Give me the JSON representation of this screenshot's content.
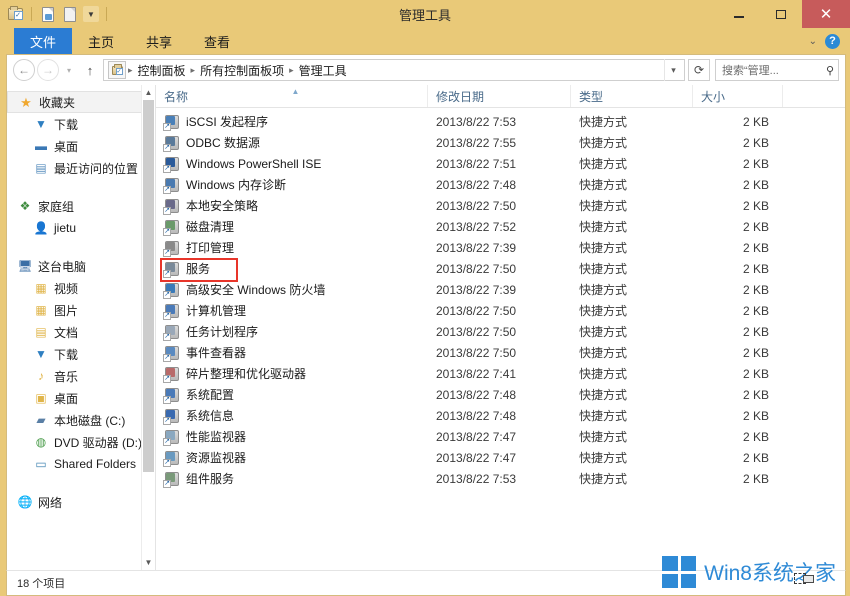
{
  "window": {
    "title": "管理工具",
    "minimize_label": "最小化",
    "maximize_label": "最大化",
    "close_label": "关闭"
  },
  "quick_access": {
    "items": [
      {
        "name": "folder-properties-icon",
        "label": "属性"
      },
      {
        "name": "new-folder-icon",
        "label": "新建文件夹"
      },
      {
        "name": "properties-icon",
        "label": "属性"
      },
      {
        "name": "customize-caret-icon",
        "label": "自定义快速访问工具栏"
      }
    ]
  },
  "ribbon": {
    "tabs": [
      {
        "label": "文件",
        "active": true
      },
      {
        "label": "主页",
        "active": false
      },
      {
        "label": "共享",
        "active": false
      },
      {
        "label": "查看",
        "active": false
      }
    ],
    "collapse_label": "展开功能区",
    "help_label": "?"
  },
  "address": {
    "back_label": "后退",
    "forward_label": "前进",
    "recent_label": "最近的位置",
    "up_label": "上移一级",
    "breadcrumbs": [
      "控制面板",
      "所有控制面板项",
      "管理工具"
    ],
    "separator": "▸",
    "dropdown_label": "▾",
    "refresh_label": "刷新",
    "search_placeholder": "搜索“管理..."
  },
  "sidebar": {
    "groups": [
      {
        "header": {
          "label": "收藏夹",
          "icon": "star-icon",
          "selected": true
        },
        "items": [
          {
            "label": "下载",
            "icon": "downloads-icon"
          },
          {
            "label": "桌面",
            "icon": "desktop-icon"
          },
          {
            "label": "最近访问的位置",
            "icon": "recent-places-icon"
          }
        ]
      },
      {
        "header": {
          "label": "家庭组",
          "icon": "homegroup-icon",
          "selected": false
        },
        "items": [
          {
            "label": "jietu",
            "icon": "user-icon"
          }
        ]
      },
      {
        "header": {
          "label": "这台电脑",
          "icon": "this-pc-icon",
          "selected": false
        },
        "items": [
          {
            "label": "视频",
            "icon": "videos-folder-icon"
          },
          {
            "label": "图片",
            "icon": "pictures-folder-icon"
          },
          {
            "label": "文档",
            "icon": "documents-folder-icon"
          },
          {
            "label": "下载",
            "icon": "downloads-folder-icon"
          },
          {
            "label": "音乐",
            "icon": "music-folder-icon"
          },
          {
            "label": "桌面",
            "icon": "desktop-folder-icon"
          },
          {
            "label": "本地磁盘 (C:)",
            "icon": "local-disk-icon"
          },
          {
            "label": "DVD 驱动器 (D:)",
            "icon": "dvd-drive-icon"
          },
          {
            "label": "Shared Folders",
            "icon": "shared-folders-icon"
          }
        ]
      },
      {
        "header": {
          "label": "网络",
          "icon": "network-icon",
          "selected": false
        },
        "items": []
      }
    ]
  },
  "filelist": {
    "columns": [
      {
        "label": "名称",
        "sorted": true
      },
      {
        "label": "修改日期",
        "sorted": false
      },
      {
        "label": "类型",
        "sorted": false
      },
      {
        "label": "大小",
        "sorted": false
      }
    ],
    "rows": [
      {
        "name": "iSCSI 发起程序",
        "date": "2013/8/22 7:53",
        "type": "快捷方式",
        "size": "2 KB",
        "icon_color": "#4a80b8",
        "highlighted": false
      },
      {
        "name": "ODBC 数据源",
        "date": "2013/8/22 7:55",
        "type": "快捷方式",
        "size": "2 KB",
        "icon_color": "#5a7a9a",
        "highlighted": false
      },
      {
        "name": "Windows PowerShell ISE",
        "date": "2013/8/22 7:51",
        "type": "快捷方式",
        "size": "2 KB",
        "icon_color": "#2a5a9a",
        "highlighted": false
      },
      {
        "name": "Windows 内存诊断",
        "date": "2013/8/22 7:48",
        "type": "快捷方式",
        "size": "2 KB",
        "icon_color": "#4a7ab0",
        "highlighted": false
      },
      {
        "name": "本地安全策略",
        "date": "2013/8/22 7:50",
        "type": "快捷方式",
        "size": "2 KB",
        "icon_color": "#6a6a8a",
        "highlighted": false
      },
      {
        "name": "磁盘清理",
        "date": "2013/8/22 7:52",
        "type": "快捷方式",
        "size": "2 KB",
        "icon_color": "#6a9a6a",
        "highlighted": false
      },
      {
        "name": "打印管理",
        "date": "2013/8/22 7:39",
        "type": "快捷方式",
        "size": "2 KB",
        "icon_color": "#8a8a8a",
        "highlighted": false
      },
      {
        "name": "服务",
        "date": "2013/8/22 7:50",
        "type": "快捷方式",
        "size": "2 KB",
        "icon_color": "#7a8a9a",
        "highlighted": true
      },
      {
        "name": "高级安全 Windows 防火墙",
        "date": "2013/8/22 7:39",
        "type": "快捷方式",
        "size": "2 KB",
        "icon_color": "#3a7ab8",
        "highlighted": false
      },
      {
        "name": "计算机管理",
        "date": "2013/8/22 7:50",
        "type": "快捷方式",
        "size": "2 KB",
        "icon_color": "#4a7ab8",
        "highlighted": false
      },
      {
        "name": "任务计划程序",
        "date": "2013/8/22 7:50",
        "type": "快捷方式",
        "size": "2 KB",
        "icon_color": "#9aa8b8",
        "highlighted": false
      },
      {
        "name": "事件查看器",
        "date": "2013/8/22 7:50",
        "type": "快捷方式",
        "size": "2 KB",
        "icon_color": "#5a8ac0",
        "highlighted": false
      },
      {
        "name": "碎片整理和优化驱动器",
        "date": "2013/8/22 7:41",
        "type": "快捷方式",
        "size": "2 KB",
        "icon_color": "#b86a6a",
        "highlighted": false
      },
      {
        "name": "系统配置",
        "date": "2013/8/22 7:48",
        "type": "快捷方式",
        "size": "2 KB",
        "icon_color": "#4a7ab8",
        "highlighted": false
      },
      {
        "name": "系统信息",
        "date": "2013/8/22 7:48",
        "type": "快捷方式",
        "size": "2 KB",
        "icon_color": "#3a6ab0",
        "highlighted": false
      },
      {
        "name": "性能监视器",
        "date": "2013/8/22 7:47",
        "type": "快捷方式",
        "size": "2 KB",
        "icon_color": "#8aa8c0",
        "highlighted": false
      },
      {
        "name": "资源监视器",
        "date": "2013/8/22 7:47",
        "type": "快捷方式",
        "size": "2 KB",
        "icon_color": "#6a9ac0",
        "highlighted": false
      },
      {
        "name": "组件服务",
        "date": "2013/8/22 7:53",
        "type": "快捷方式",
        "size": "2 KB",
        "icon_color": "#7a9a7a",
        "highlighted": false
      }
    ]
  },
  "statusbar": {
    "item_count_text": "18 个项目"
  },
  "watermark": {
    "text": "Win8系统之家",
    "color": "#2e8ad6"
  },
  "colors": {
    "titlebar": "#e9c978",
    "file_tab": "#2b7cd3",
    "close_button": "#c75b5b",
    "highlight_box": "#e8352a",
    "column_header_text": "#4a6b8a"
  }
}
